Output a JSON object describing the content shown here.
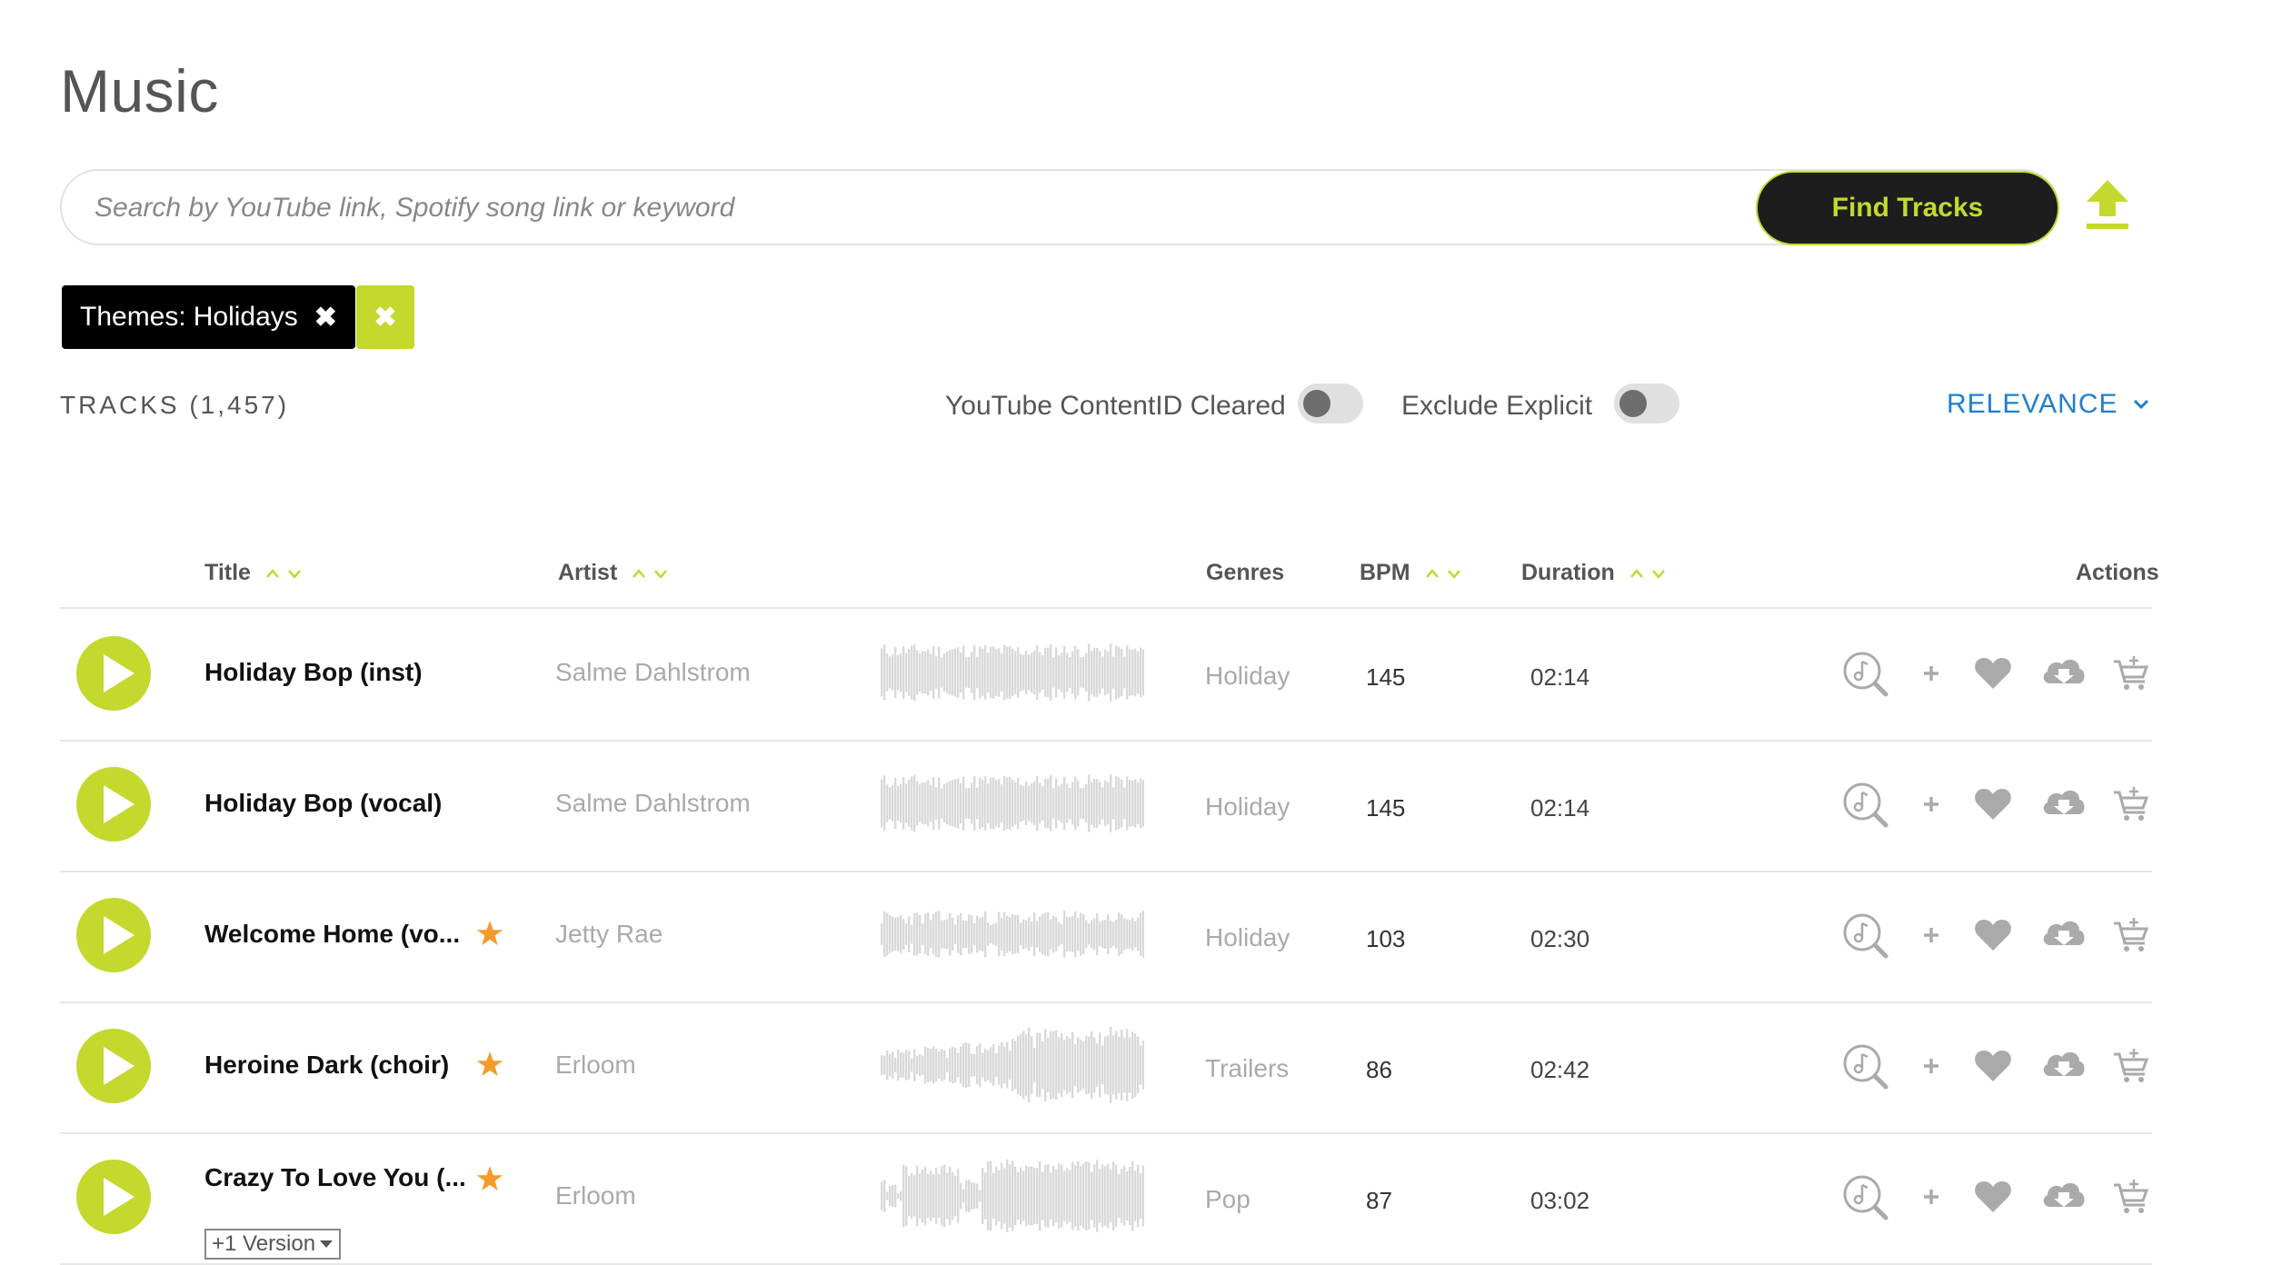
{
  "page": {
    "title": "Music"
  },
  "search": {
    "placeholder": "Search by YouTube link, Spotify song link or keyword",
    "button_label": "Find Tracks"
  },
  "filters": {
    "chip_label": "Themes:",
    "chip_value": "Holidays",
    "chip_remove": "✖",
    "clear_all": "✖"
  },
  "results": {
    "tracks_count": "TRACKS (1,457)",
    "toggle_contentid_label": "YouTube ContentID Cleared",
    "toggle_explicit_label": "Exclude Explicit",
    "sort_label": "RELEVANCE",
    "sort_chevron": "⌄"
  },
  "table": {
    "headers": {
      "title": "Title",
      "artist": "Artist",
      "genres": "Genres",
      "bpm": "BPM",
      "duration": "Duration",
      "actions": "Actions",
      "sort_arrows": "^v"
    },
    "rows": [
      {
        "title": "Holiday Bop (inst)",
        "starred": false,
        "artist": "Salme Dahlstrom",
        "genre": "Holiday",
        "bpm": "145",
        "duration": "02:14"
      },
      {
        "title": "Holiday Bop (vocal)",
        "starred": false,
        "artist": "Salme Dahlstrom",
        "genre": "Holiday",
        "bpm": "145",
        "duration": "02:14"
      },
      {
        "title": "Welcome Home (vo...",
        "starred": true,
        "artist": "Jetty Rae",
        "genre": "Holiday",
        "bpm": "103",
        "duration": "02:30"
      },
      {
        "title": "Heroine Dark (choir)",
        "starred": true,
        "artist": "Erloom",
        "genre": "Trailers",
        "bpm": "86",
        "duration": "02:42"
      },
      {
        "title": "Crazy To Love You (...",
        "starred": true,
        "artist": "Erloom",
        "genre": "Pop",
        "bpm": "87",
        "duration": "03:02",
        "version_label": "+1 Version"
      }
    ]
  },
  "icons": {
    "play": "play-icon",
    "star": "star-icon",
    "upload": "upload-icon",
    "find_similar": "find-similar-icon",
    "add": "plus-icon",
    "favorite": "heart-icon",
    "download": "cloud-download-icon",
    "cart": "cart-icon"
  },
  "colors": {
    "accent": "#c4d82e",
    "dark": "#1d1d1d",
    "link_blue": "#1f7fcc",
    "star": "#f39c2a",
    "muted": "#aaaaaa"
  }
}
